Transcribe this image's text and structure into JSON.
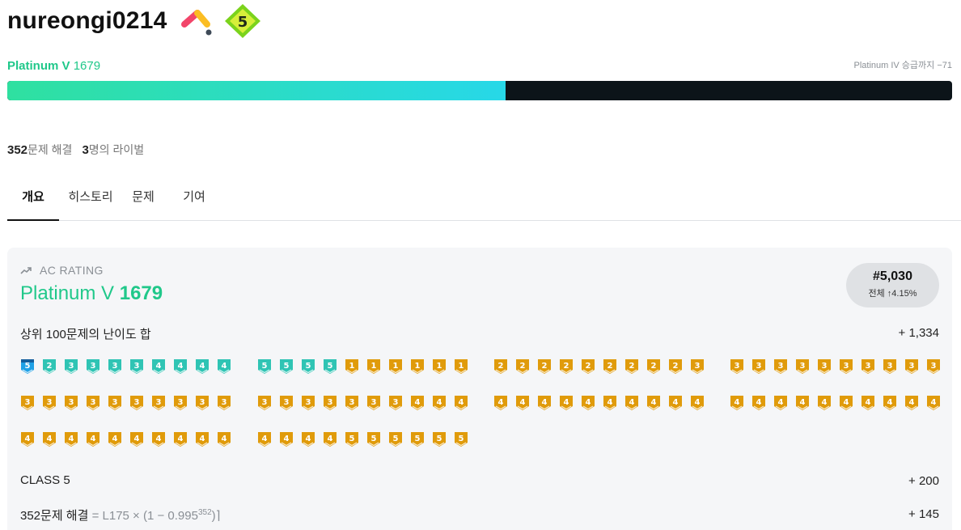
{
  "profile": {
    "username": "nureongi0214",
    "class_badge": "5",
    "tier_name": "Platinum V",
    "rating": "1679",
    "next_tier_text": "Platinum IV 승급까지 −71",
    "progress": 0.527
  },
  "stats": {
    "solved_count": "352",
    "solved_label": "문제 해결",
    "rival_count": "3",
    "rival_label": "명의 라이벌"
  },
  "tabs": [
    "개요",
    "히스토리",
    "문제",
    "기여"
  ],
  "rating_card": {
    "section_label": "AC RATING",
    "tier_name": "Platinum V",
    "rating": "1679",
    "rank": "#5,030",
    "rank_detail": "전체 ↑4.15%",
    "top100_label": "상위 100문제의 난이도 합",
    "top100_value": "+ 1,334",
    "class_label": "CLASS 5",
    "class_value": "+ 200",
    "solved_formula_prefix": "352문제 해결",
    "solved_formula_rest": "= L175 × (1 − 0.995",
    "solved_formula_exp": "352",
    "solved_formula_suffix": ")⌉",
    "solved_value": "+ 145"
  },
  "colors": {
    "platinum": "#20c88a",
    "gold": "#e09b0b",
    "ruby_fill": "#1ea0e6",
    "diamond": "#2fc4b4"
  },
  "top100_problems": {
    "columns": [
      [
        [
          "d",
          5
        ],
        [
          "p",
          2
        ],
        [
          "p",
          3
        ],
        [
          "p",
          3
        ],
        [
          "p",
          3
        ],
        [
          "p",
          3
        ],
        [
          "p",
          4
        ],
        [
          "p",
          4
        ],
        [
          "p",
          4
        ],
        [
          "p",
          4
        ],
        [
          "g",
          3
        ],
        [
          "g",
          3
        ],
        [
          "g",
          3
        ],
        [
          "g",
          3
        ],
        [
          "g",
          3
        ],
        [
          "g",
          3
        ],
        [
          "g",
          3
        ],
        [
          "g",
          3
        ],
        [
          "g",
          3
        ],
        [
          "g",
          3
        ],
        [
          "g",
          4
        ],
        [
          "g",
          4
        ],
        [
          "g",
          4
        ],
        [
          "g",
          4
        ],
        [
          "g",
          4
        ],
        [
          "g",
          4
        ],
        [
          "g",
          4
        ],
        [
          "g",
          4
        ],
        [
          "g",
          4
        ],
        [
          "g",
          4
        ]
      ],
      [
        [
          "p",
          5
        ],
        [
          "p",
          5
        ],
        [
          "p",
          5
        ],
        [
          "p",
          5
        ],
        [
          "g",
          1
        ],
        [
          "g",
          1
        ],
        [
          "g",
          1
        ],
        [
          "g",
          1
        ],
        [
          "g",
          1
        ],
        [
          "g",
          1
        ],
        [
          "g",
          3
        ],
        [
          "g",
          3
        ],
        [
          "g",
          3
        ],
        [
          "g",
          3
        ],
        [
          "g",
          3
        ],
        [
          "g",
          3
        ],
        [
          "g",
          3
        ],
        [
          "g",
          4
        ],
        [
          "g",
          4
        ],
        [
          "g",
          4
        ],
        [
          "g",
          4
        ],
        [
          "g",
          4
        ],
        [
          "g",
          4
        ],
        [
          "g",
          4
        ],
        [
          "g",
          5
        ],
        [
          "g",
          5
        ],
        [
          "g",
          5
        ],
        [
          "g",
          5
        ],
        [
          "g",
          5
        ],
        [
          "g",
          5
        ]
      ],
      [
        [
          "g",
          2
        ],
        [
          "g",
          2
        ],
        [
          "g",
          2
        ],
        [
          "g",
          2
        ],
        [
          "g",
          2
        ],
        [
          "g",
          2
        ],
        [
          "g",
          2
        ],
        [
          "g",
          2
        ],
        [
          "g",
          2
        ],
        [
          "g",
          3
        ],
        [
          "g",
          4
        ],
        [
          "g",
          4
        ],
        [
          "g",
          4
        ],
        [
          "g",
          4
        ],
        [
          "g",
          4
        ],
        [
          "g",
          4
        ],
        [
          "g",
          4
        ],
        [
          "g",
          4
        ],
        [
          "g",
          4
        ],
        [
          "g",
          4
        ]
      ],
      [
        [
          "g",
          3
        ],
        [
          "g",
          3
        ],
        [
          "g",
          3
        ],
        [
          "g",
          3
        ],
        [
          "g",
          3
        ],
        [
          "g",
          3
        ],
        [
          "g",
          3
        ],
        [
          "g",
          3
        ],
        [
          "g",
          3
        ],
        [
          "g",
          3
        ],
        [
          "g",
          4
        ],
        [
          "g",
          4
        ],
        [
          "g",
          4
        ],
        [
          "g",
          4
        ],
        [
          "g",
          4
        ],
        [
          "g",
          4
        ],
        [
          "g",
          4
        ],
        [
          "g",
          4
        ],
        [
          "g",
          4
        ],
        [
          "g",
          4
        ]
      ]
    ]
  }
}
